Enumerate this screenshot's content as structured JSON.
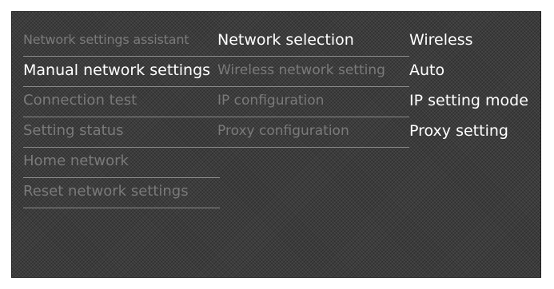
{
  "menu": {
    "column1": [
      {
        "label": "Network settings assistant",
        "state": "inactive"
      },
      {
        "label": "Manual network settings",
        "state": "active"
      },
      {
        "label": "Connection test",
        "state": "inactive"
      },
      {
        "label": "Setting status",
        "state": "inactive"
      },
      {
        "label": "Home network",
        "state": "inactive"
      },
      {
        "label": "Reset network settings",
        "state": "inactive"
      }
    ],
    "column2": [
      {
        "label": "Network selection",
        "state": "active"
      },
      {
        "label": "Wireless network setting",
        "state": "inactive"
      },
      {
        "label": "IP configuration",
        "state": "inactive"
      },
      {
        "label": "Proxy configuration",
        "state": "inactive"
      }
    ],
    "column3": [
      {
        "label": "Wireless",
        "state": "active"
      },
      {
        "label": "Auto",
        "state": "active"
      },
      {
        "label": "IP setting mode",
        "state": "active"
      },
      {
        "label": "Proxy setting",
        "state": "active"
      }
    ]
  },
  "colors": {
    "background": "#3c3c3c",
    "text_active": "#ffffff",
    "text_inactive": "#7a7a7a",
    "divider": "#8a8a8a"
  }
}
